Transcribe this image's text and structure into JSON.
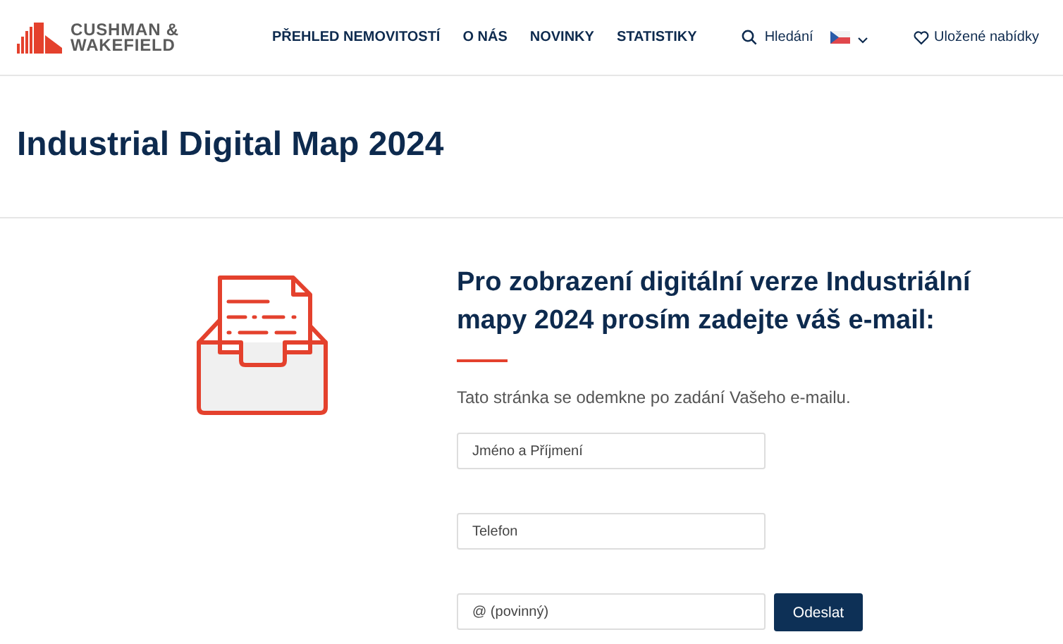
{
  "header": {
    "logo": [
      "CUSHMAN &",
      "WAKEFIELD"
    ],
    "nav": [
      {
        "label": "PŘEHLED NEMOVITOSTÍ"
      },
      {
        "label": "O NÁS"
      },
      {
        "label": "NOVINKY"
      },
      {
        "label": "STATISTIKY"
      }
    ],
    "search": "Hledání",
    "saved": "Uložené nabídky"
  },
  "title": "Industrial Digital Map 2024",
  "form": {
    "heading": "Pro zobrazení digitální verze Industriální mapy 2024 prosím zadejte váš e-mail:",
    "note": "Tato stránka se odemkne po zadání Vašeho e-mailu.",
    "fields": [
      {
        "placeholder": "Jméno a Příjmení"
      },
      {
        "placeholder": "Telefon"
      },
      {
        "placeholder": "@ (povinný)"
      }
    ],
    "submit": "Odeslat"
  }
}
